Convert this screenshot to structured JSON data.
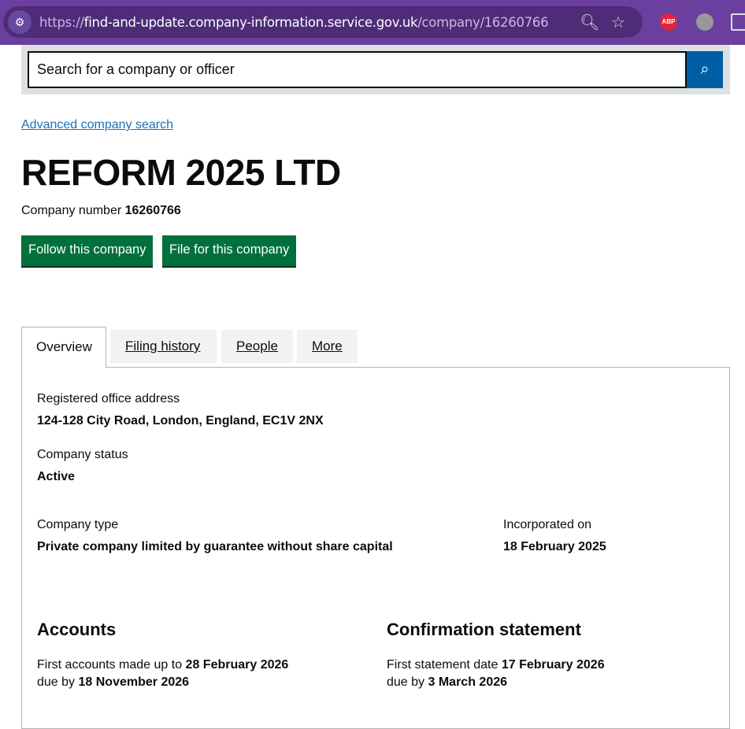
{
  "browser": {
    "url_scheme": "https://",
    "url_host": "find-and-update.company-information.service.gov.uk",
    "url_path": "/company/16260766",
    "abp_label": "ABP"
  },
  "search": {
    "placeholder": "Search for a company or officer"
  },
  "advanced_search_link": "Advanced company search",
  "company": {
    "name": "REFORM 2025 LTD",
    "number_label": "Company number",
    "number": "16260766"
  },
  "actions": {
    "follow": "Follow this company",
    "file": "File for this company"
  },
  "tabs": [
    {
      "label": "Overview",
      "active": true
    },
    {
      "label": "Filing history"
    },
    {
      "label": "People"
    },
    {
      "label": "More"
    }
  ],
  "overview": {
    "address_label": "Registered office address",
    "address": "124-128 City Road, London, England, EC1V 2NX",
    "status_label": "Company status",
    "status": "Active",
    "type_label": "Company type",
    "type": "Private company limited by guarantee without share capital",
    "incorporated_label": "Incorporated on",
    "incorporated": "18 February 2025",
    "accounts": {
      "heading": "Accounts",
      "line1_label": "First accounts made up to",
      "line1_value": "28 February 2026",
      "line2_label": "due by",
      "line2_value": "18 November 2026"
    },
    "confirmation": {
      "heading": "Confirmation statement",
      "line1_label": "First statement date",
      "line1_value": "17 February 2026",
      "line2_label": "due by",
      "line2_value": "3 March 2026"
    }
  }
}
